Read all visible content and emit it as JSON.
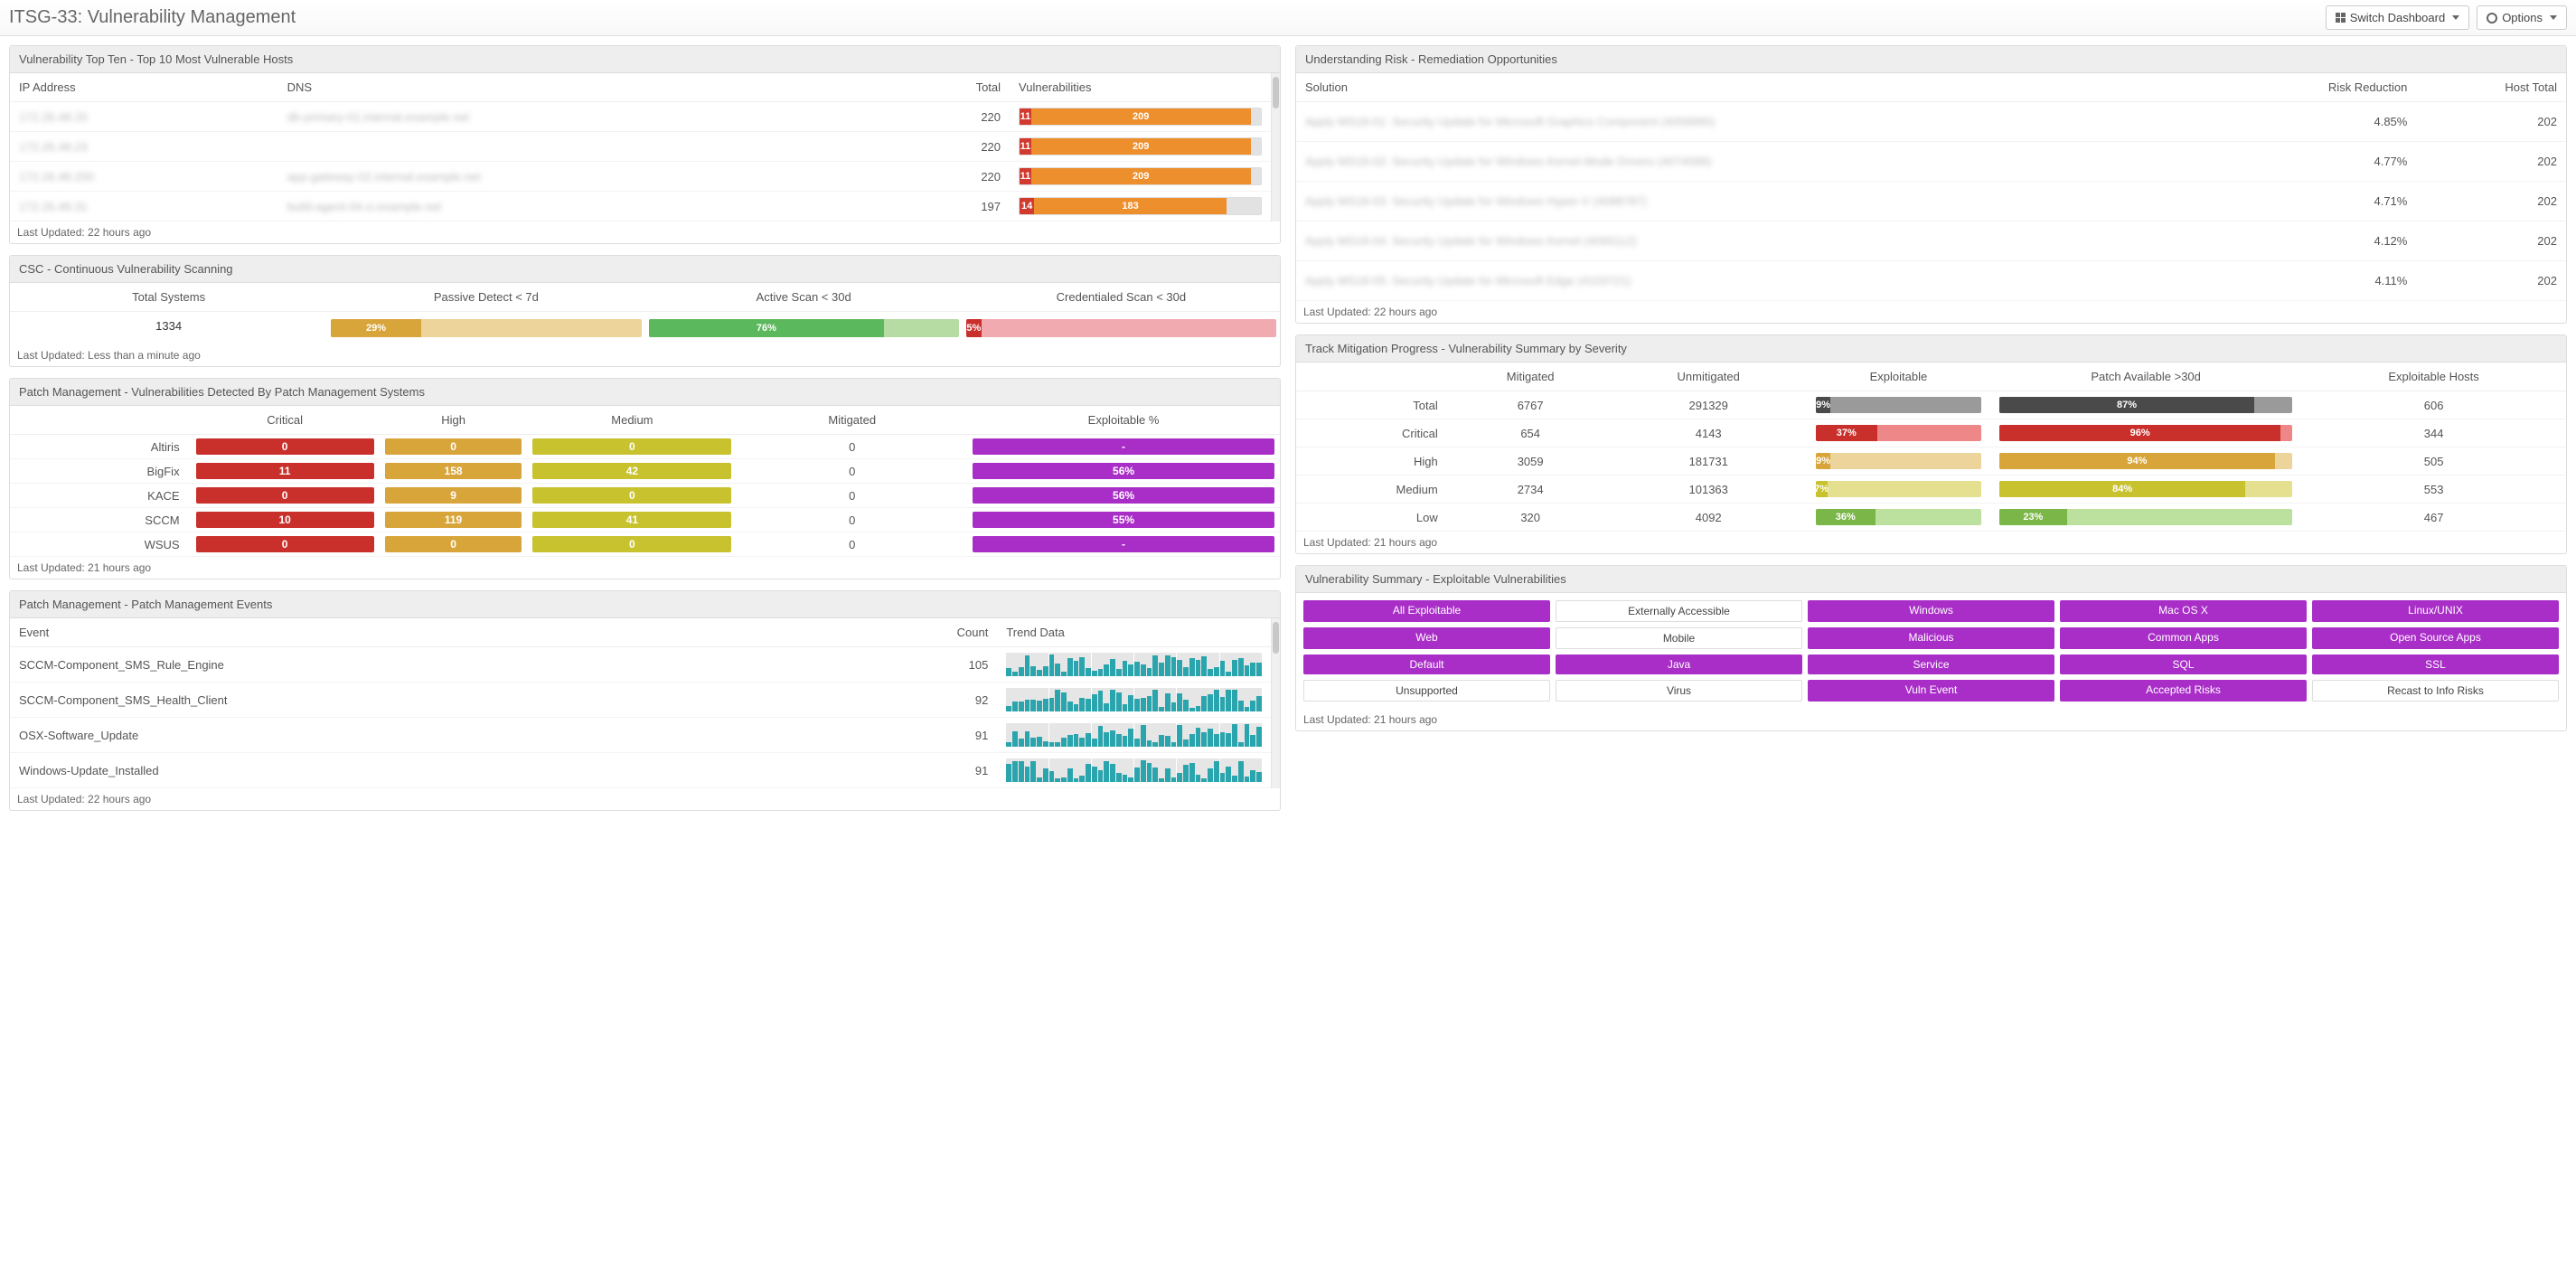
{
  "title": "ITSG-33: Vulnerability Management",
  "header": {
    "switch_dashboard": "Switch Dashboard",
    "options": "Options"
  },
  "top10": {
    "title": "Vulnerability Top Ten - Top 10 Most Vulnerable Hosts",
    "cols": {
      "ip": "IP Address",
      "dns": "DNS",
      "total": "Total",
      "vuln": "Vulnerabilities"
    },
    "rows": [
      {
        "ip": "172.26.48.20",
        "dns": "db-primary-01.internal.example.net",
        "total": 220,
        "crit": 11,
        "high": 209
      },
      {
        "ip": "172.26.48.23",
        "dns": "",
        "total": 220,
        "crit": 11,
        "high": 209
      },
      {
        "ip": "172.26.48.200",
        "dns": "app-gateway-02.internal.example.net",
        "total": 220,
        "crit": 11,
        "high": 209
      },
      {
        "ip": "172.26.48.31",
        "dns": "build-agent-04.ci.example.net",
        "total": 197,
        "crit": 14,
        "high": 183
      }
    ],
    "updated": "Last Updated: 22 hours ago"
  },
  "csc": {
    "title": "CSC - Continuous Vulnerability Scanning",
    "cols": {
      "total": "Total Systems",
      "passive": "Passive Detect < 7d",
      "active": "Active Scan < 30d",
      "cred": "Credentialed Scan < 30d"
    },
    "total": 1334,
    "passive_pct": 29,
    "active_pct": 76,
    "cred_pct": 5,
    "updated": "Last Updated: Less than a minute ago"
  },
  "patch_mgmt": {
    "title": "Patch Management - Vulnerabilities Detected By Patch Management Systems",
    "cols": {
      "critical": "Critical",
      "high": "High",
      "medium": "Medium",
      "mitigated": "Mitigated",
      "exploit": "Exploitable %"
    },
    "rows": [
      {
        "name": "Altiris",
        "critical": 0,
        "high": 0,
        "medium": 0,
        "mitigated": 0,
        "exploit": "-"
      },
      {
        "name": "BigFix",
        "critical": 11,
        "high": 158,
        "medium": 42,
        "mitigated": 0,
        "exploit": "56%"
      },
      {
        "name": "KACE",
        "critical": 0,
        "high": 9,
        "medium": 0,
        "mitigated": 0,
        "exploit": "56%"
      },
      {
        "name": "SCCM",
        "critical": 10,
        "high": 119,
        "medium": 41,
        "mitigated": 0,
        "exploit": "55%"
      },
      {
        "name": "WSUS",
        "critical": 0,
        "high": 0,
        "medium": 0,
        "mitigated": 0,
        "exploit": "-"
      }
    ],
    "updated": "Last Updated: 21 hours ago"
  },
  "patch_events": {
    "title": "Patch Management - Patch Management Events",
    "cols": {
      "event": "Event",
      "count": "Count",
      "trend": "Trend Data"
    },
    "rows": [
      {
        "event": "SCCM-Component_SMS_Rule_Engine",
        "count": 105
      },
      {
        "event": "SCCM-Component_SMS_Health_Client",
        "count": 92
      },
      {
        "event": "OSX-Software_Update",
        "count": 91
      },
      {
        "event": "Windows-Update_Installed",
        "count": 91
      }
    ],
    "updated": "Last Updated: 22 hours ago"
  },
  "risk": {
    "title": "Understanding Risk - Remediation Opportunities",
    "cols": {
      "solution": "Solution",
      "reduction": "Risk Reduction",
      "hosts": "Host Total"
    },
    "rows": [
      {
        "solution": "Apply MS18-01: Security Update for Microsoft Graphics Component (4056890)",
        "reduction": "4.85%",
        "hosts": 202
      },
      {
        "solution": "Apply MS18-02: Security Update for Windows Kernel-Mode Drivers (4074588)",
        "reduction": "4.77%",
        "hosts": 202
      },
      {
        "solution": "Apply MS18-03: Security Update for Windows Hyper-V (4088787)",
        "reduction": "4.71%",
        "hosts": 202
      },
      {
        "solution": "Apply MS18-04: Security Update for Windows Kernel (4093112)",
        "reduction": "4.12%",
        "hosts": 202
      },
      {
        "solution": "Apply MS18-05: Security Update for Microsoft Edge (4103721)",
        "reduction": "4.11%",
        "hosts": 202
      }
    ],
    "updated": "Last Updated: 22 hours ago"
  },
  "mitigation": {
    "title": "Track Mitigation Progress - Vulnerability Summary by Severity",
    "cols": {
      "mitigated": "Mitigated",
      "unmitigated": "Unmitigated",
      "exploitable": "Exploitable",
      "patch": "Patch Available >30d",
      "hosts": "Exploitable Hosts"
    },
    "rows": [
      {
        "label": "Total",
        "mitigated": 6767,
        "unmitigated": 291329,
        "exploit_pct": 9,
        "patch_pct": 87,
        "hosts": 606,
        "cls": "bk"
      },
      {
        "label": "Critical",
        "mitigated": 654,
        "unmitigated": 4143,
        "exploit_pct": 37,
        "patch_pct": 96,
        "hosts": 344,
        "cls": "rd"
      },
      {
        "label": "High",
        "mitigated": 3059,
        "unmitigated": 181731,
        "exploit_pct": 9,
        "patch_pct": 94,
        "hosts": 505,
        "cls": "am"
      },
      {
        "label": "Medium",
        "mitigated": 2734,
        "unmitigated": 101363,
        "exploit_pct": 7,
        "patch_pct": 84,
        "hosts": 553,
        "cls": "ol"
      },
      {
        "label": "Low",
        "mitigated": 320,
        "unmitigated": 4092,
        "exploit_pct": 36,
        "patch_pct": 23,
        "hosts": 467,
        "cls": "gn"
      }
    ],
    "updated": "Last Updated: 21 hours ago"
  },
  "vuln_summary": {
    "title": "Vulnerability Summary - Exploitable Vulnerabilities",
    "tags": [
      {
        "label": "All Exploitable",
        "style": "p"
      },
      {
        "label": "Externally Accessible",
        "style": "plain"
      },
      {
        "label": "Windows",
        "style": "p"
      },
      {
        "label": "Mac OS X",
        "style": "p"
      },
      {
        "label": "Linux/UNIX",
        "style": "p"
      },
      {
        "label": "Web",
        "style": "p"
      },
      {
        "label": "Mobile",
        "style": "plain"
      },
      {
        "label": "Malicious",
        "style": "p"
      },
      {
        "label": "Common Apps",
        "style": "p"
      },
      {
        "label": "Open Source Apps",
        "style": "p"
      },
      {
        "label": "Default",
        "style": "p"
      },
      {
        "label": "Java",
        "style": "p"
      },
      {
        "label": "Service",
        "style": "p"
      },
      {
        "label": "SQL",
        "style": "p"
      },
      {
        "label": "SSL",
        "style": "p"
      },
      {
        "label": "Unsupported",
        "style": "plain"
      },
      {
        "label": "Virus",
        "style": "plain"
      },
      {
        "label": "Vuln Event",
        "style": "p"
      },
      {
        "label": "Accepted Risks",
        "style": "p"
      },
      {
        "label": "Recast to Info Risks",
        "style": "plain"
      }
    ],
    "updated": "Last Updated: 21 hours ago"
  }
}
